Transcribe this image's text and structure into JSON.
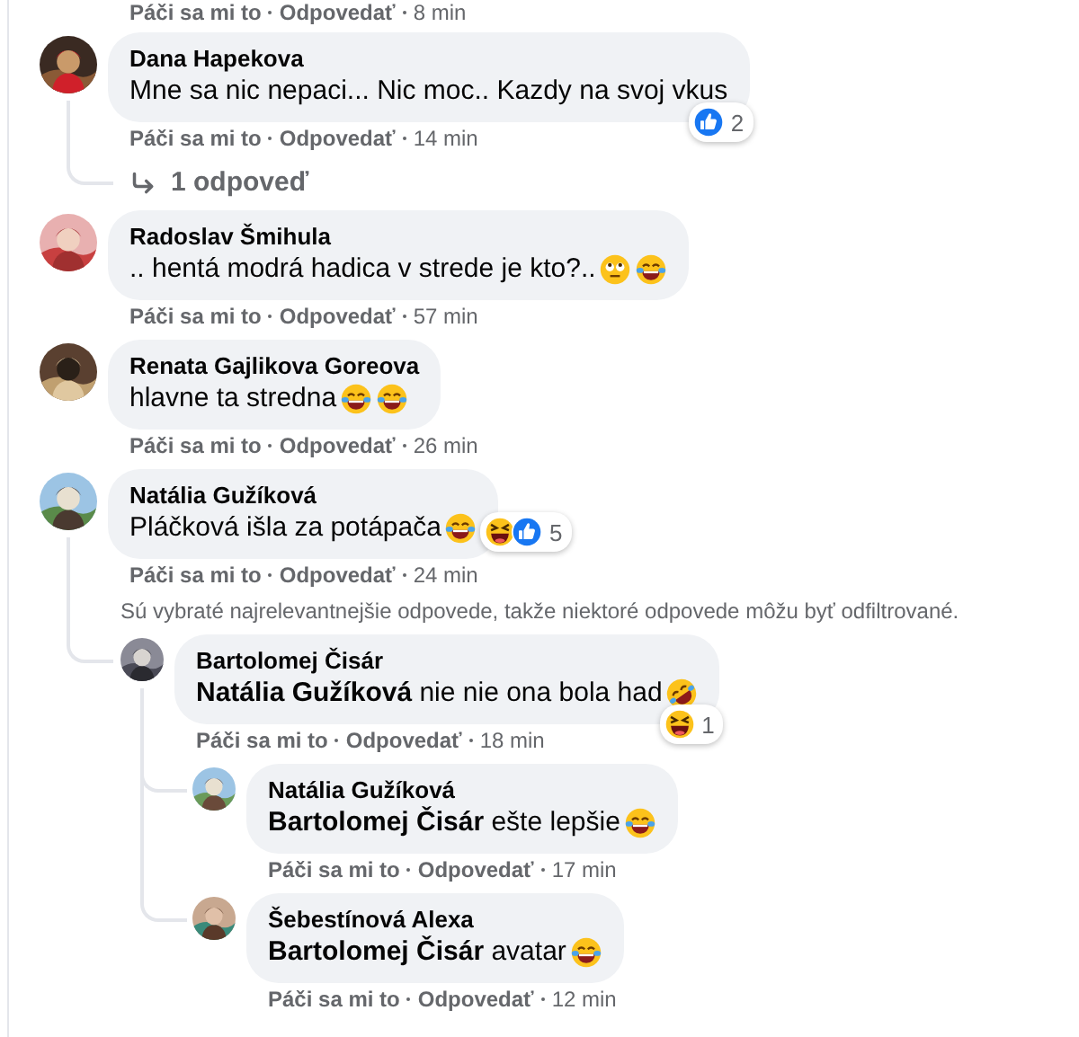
{
  "previous_comment_meta": {
    "like": "Páči sa mi to",
    "reply": "Odpovedať",
    "time": "8 min"
  },
  "comments": [
    {
      "kind": "comment",
      "avatar": {
        "kind": "picture"
      },
      "author": "Dana Hapekova",
      "text": "Mne sa nic nepaci... Nic moc.. Kazdy na svoj vkus",
      "reactions": {
        "icons": [
          {
            "kind": "like"
          }
        ],
        "count": "2"
      },
      "like": "Páči sa mi to",
      "reply": "Odpovedať",
      "time": "14 min",
      "children": [
        {
          "kind": "more_replies",
          "label": "1 odpoveď"
        }
      ]
    },
    {
      "kind": "comment",
      "avatar": {
        "kind": "picture"
      },
      "author": "Radoslav Šmihula",
      "text": ".. hentá modrá hadica v strede je kto?..",
      "emojis": [
        {
          "kind": "eye_roll"
        },
        {
          "kind": "tears_of_joy"
        }
      ],
      "like": "Páči sa mi to",
      "reply": "Odpovedať",
      "time": "57 min"
    },
    {
      "kind": "comment",
      "avatar": {
        "kind": "picture"
      },
      "author": "Renata Gajlikova Goreova",
      "text": "hlavne ta stredna",
      "emojis": [
        {
          "kind": "tears_of_joy"
        },
        {
          "kind": "tears_of_joy"
        }
      ],
      "like": "Páči sa mi to",
      "reply": "Odpovedať",
      "time": "26 min"
    },
    {
      "kind": "comment",
      "avatar": {
        "kind": "picture"
      },
      "author": "Natália Gužíková",
      "text": "Pláčková išla za potápača",
      "emojis": [
        {
          "kind": "tears_of_joy"
        }
      ],
      "reactions": {
        "icons": [
          {
            "kind": "haha"
          },
          {
            "kind": "like"
          }
        ],
        "count": "5"
      },
      "like": "Páči sa mi to",
      "reply": "Odpovedať",
      "time": "24 min",
      "children": [
        {
          "kind": "note",
          "text": "Sú vybraté najrelevantnejšie odpovede, takže niektoré odpovede môžu byť odfiltrované."
        },
        {
          "kind": "comment",
          "avatar": {
            "kind": "picture"
          },
          "author": "Bartolomej Čisár",
          "text": "**Natália Gužíková** nie nie ona bola had",
          "emojis": [
            {
              "kind": "rofl"
            }
          ],
          "reactions": {
            "icons": [
              {
                "kind": "haha"
              }
            ],
            "count": "1"
          },
          "like": "Páči sa mi to",
          "reply": "Odpovedať",
          "time": "18 min",
          "children": [
            {
              "kind": "comment",
              "avatar": {
                "kind": "picture"
              },
              "author": "Natália Gužíková",
              "text": "**Bartolomej Čisár** ešte lepšie",
              "emojis": [
                {
                  "kind": "tears_of_joy"
                }
              ],
              "like": "Páči sa mi to",
              "reply": "Odpovedať",
              "time": "17 min"
            },
            {
              "kind": "comment",
              "avatar": {
                "kind": "picture"
              },
              "author": "Šebestínová Alexa",
              "text": "**Bartolomej Čisár** avatar",
              "emojis": [
                {
                  "kind": "tears_of_joy"
                }
              ],
              "like": "Páči sa mi to",
              "reply": "Odpovedať",
              "time": "12 min"
            }
          ]
        }
      ]
    }
  ]
}
